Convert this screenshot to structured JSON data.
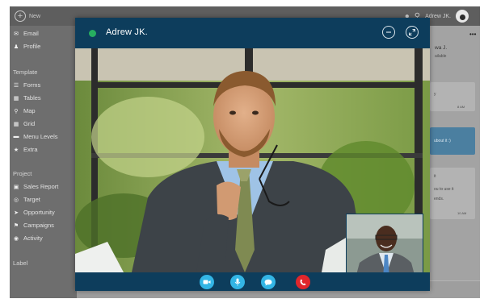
{
  "topbar": {
    "new_label": "New",
    "user_name": "Adrew JK."
  },
  "sidebar": {
    "items_top": [
      {
        "label": "Email",
        "icon": "envelope-icon"
      },
      {
        "label": "Profile",
        "icon": "person-icon"
      }
    ],
    "template_title": "Template",
    "template_items": [
      {
        "label": "Forms",
        "icon": "list-icon"
      },
      {
        "label": "Tables",
        "icon": "table-icon"
      },
      {
        "label": "Map",
        "icon": "map-pin-icon"
      },
      {
        "label": "Grid",
        "icon": "grid-icon"
      },
      {
        "label": "Menu Levels",
        "icon": "folder-icon"
      },
      {
        "label": "Extra",
        "icon": "star-icon"
      }
    ],
    "project_title": "Project",
    "project_items": [
      {
        "label": "Sales Report",
        "icon": "file-icon"
      },
      {
        "label": "Target",
        "icon": "target-icon"
      },
      {
        "label": "Opportunity",
        "icon": "send-icon"
      },
      {
        "label": "Campaigns",
        "icon": "bookmark-icon"
      },
      {
        "label": "Activity",
        "icon": "chat-icon"
      }
    ],
    "label_title": "Label"
  },
  "chat": {
    "header_name": "wa J.",
    "header_sub": "ailable",
    "msg1": "y",
    "time1": "8 AM",
    "msg2": "ubout it :)",
    "msg3a": "it",
    "msg3b": "ou to use it",
    "msg3c": "ends.",
    "time3": "10 AM",
    "menu": "•••"
  },
  "video_call": {
    "caller_name": "Adrew JK.",
    "status_color": "#27ae60",
    "accent": "#33b5e5",
    "end_call_color": "#e0262b",
    "controls": [
      "video-camera-icon",
      "microphone-icon",
      "chat-bubble-icon",
      "phone-hangup-icon"
    ]
  }
}
